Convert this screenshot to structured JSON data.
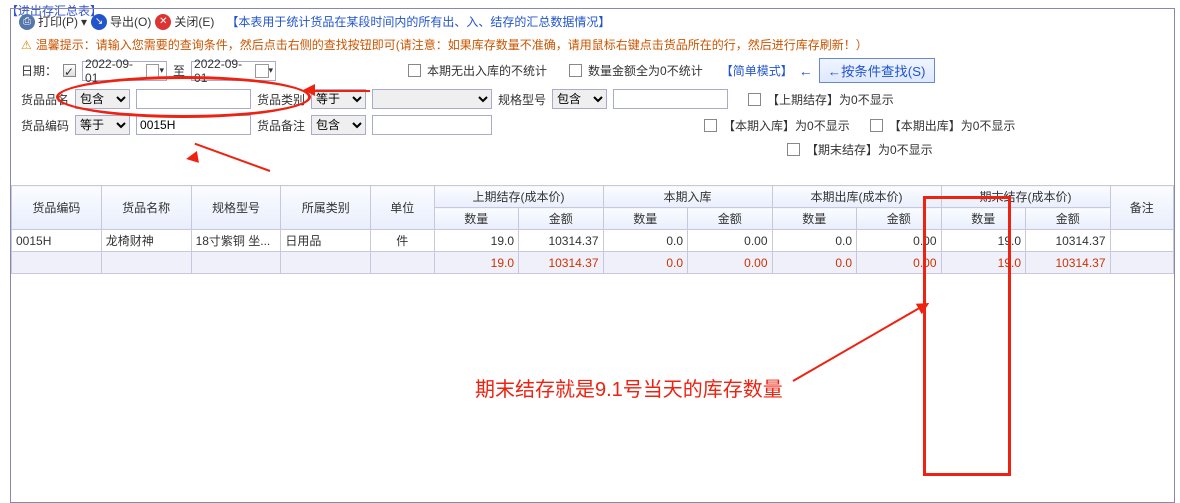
{
  "title": "【进出存汇总表】",
  "toolbar": {
    "print": "打印(P)",
    "export": "导出(O)",
    "close": "关闭(E)",
    "note": "【本表用于统计货品在某段时间内的所有出、入、结存的汇总数据情况】"
  },
  "hint": "温馨提示：请输入您需要的查询条件，然后点击右侧的查找按钮即可(请注意：如果库存数量不准确，请用鼠标右键点击货品所在的行，然后进行库存刷新！）",
  "filters": {
    "date_label": "日期：",
    "date_from": "2022-09-01",
    "date_to_label": "至",
    "date_to": "2022-09-01",
    "cb_no_io": "本期无出入库的不统计",
    "cb_zero": "数量金额全为0不统计",
    "simple_mode": "【简单模式】",
    "search_btn": "←按条件查找(S)",
    "name_label": "货品品名",
    "op_contain": "包含",
    "cat_label": "货品类别",
    "op_eq": "等于",
    "spec_label": "规格型号",
    "code_label": "货品编码",
    "code_value": "0015H",
    "remark_label": "货品备注",
    "cb_sq": "【上期结存】为0不显示",
    "cb_in": "【本期入库】为0不显示",
    "cb_out": "【本期出库】为0不显示",
    "cb_mq": "【期末结存】为0不显示"
  },
  "headers": {
    "code": "货品编码",
    "name": "货品名称",
    "spec": "规格型号",
    "cat": "所属类别",
    "unit": "单位",
    "sq": "上期结存(成本价)",
    "in": "本期入库",
    "out": "本期出库(成本价)",
    "mq": "期末结存(成本价)",
    "remark": "备注",
    "qty": "数量",
    "amt": "金额"
  },
  "rows": [
    {
      "code": "0015H",
      "name": "龙椅财神",
      "spec": "18寸紫铜 坐...",
      "cat": "日用品",
      "unit": "件",
      "sq_qty": "19.0",
      "sq_amt": "10314.37",
      "in_qty": "0.0",
      "in_amt": "0.00",
      "out_qty": "0.0",
      "out_amt": "0.00",
      "mq_qty": "19.0",
      "mq_amt": "10314.37"
    }
  ],
  "sum": {
    "sq_qty": "19.0",
    "sq_amt": "10314.37",
    "in_qty": "0.0",
    "in_amt": "0.00",
    "out_qty": "0.0",
    "out_amt": "0.00",
    "mq_qty": "19.0",
    "mq_amt": "10314.37"
  },
  "annotation": "期末结存就是9.1号当天的库存数量"
}
